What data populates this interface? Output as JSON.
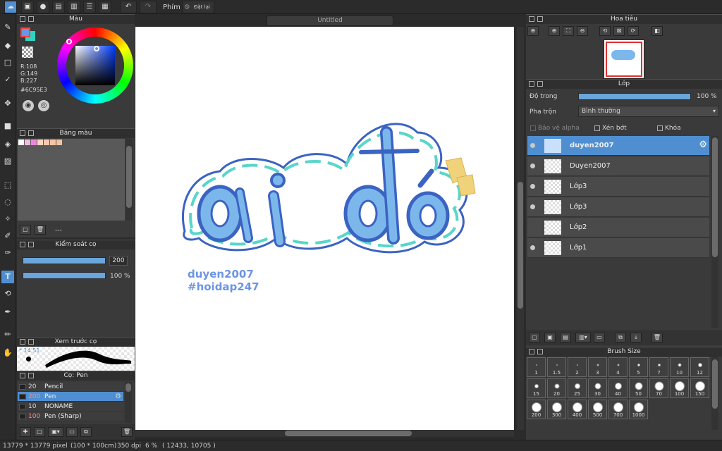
{
  "toolbar": {
    "hotkey_label": "Phím",
    "reset_label": "Đặt lại"
  },
  "document": {
    "title": "Untitled"
  },
  "color_panel": {
    "title": "Màu",
    "r": "R:108",
    "g": "G:149",
    "b": "B:227",
    "hex": "#6C95E3",
    "main_color": "#6C95E3",
    "sub_color": "#2ED3C3"
  },
  "palette_panel": {
    "title": "Bảng màu",
    "name": "---",
    "swatches": [
      "#ffffff",
      "#f5b8e6",
      "#e98ad8",
      "#fbd7c0",
      "#f7c9b2",
      "#f4c6a8",
      "#f2c3a0"
    ]
  },
  "brush_control": {
    "title": "Kiểm soát cọ",
    "size_value": "200",
    "opacity_value": "100 %"
  },
  "brush_preview": {
    "title": "Xem trước cọ",
    "size_label": "* 14.51"
  },
  "brush_list": {
    "title": "Cọ: Pen",
    "items": [
      {
        "size": "20",
        "name": "Pencil"
      },
      {
        "size": "200",
        "name": "Pen"
      },
      {
        "size": "10",
        "name": "NONAME"
      },
      {
        "size": "100",
        "name": "Pen (Sharp)"
      }
    ]
  },
  "canvas": {
    "art_title": "ai đó",
    "caption_line1": "duyen2007",
    "caption_line2": "#hoidap247"
  },
  "navigator": {
    "title": "Hoa tiêu"
  },
  "layer_panel": {
    "title": "Lớp",
    "opacity_label": "Độ trong",
    "opacity_value": "100 %",
    "blend_label": "Pha trộn",
    "blend_value": "Bình thường",
    "protect_alpha": "Bảo vệ alpha",
    "clipping": "Xén bớt",
    "lock": "Khóa",
    "layers": [
      {
        "name": "duyen2007"
      },
      {
        "name": "Duyen2007"
      },
      {
        "name": "Lớp3"
      },
      {
        "name": "Lớp3"
      },
      {
        "name": "Lớp2"
      },
      {
        "name": "Lớp1"
      }
    ]
  },
  "brush_size_panel": {
    "title": "Brush Size",
    "sizes": [
      "1",
      "1.5",
      "2",
      "3",
      "4",
      "5",
      "7",
      "10",
      "12",
      "15",
      "20",
      "25",
      "30",
      "40",
      "50",
      "70",
      "100",
      "150",
      "200",
      "300",
      "400",
      "500",
      "700",
      "1000"
    ]
  },
  "status_bar": {
    "dims": "13779 * 13779 pixel",
    "physical": "(100 * 100cm)",
    "dpi": "350 dpi",
    "zoom": "6 %",
    "coords": "( 12433, 10705 )"
  },
  "colors": {
    "accent": "#4f8fd1",
    "panel_bg": "#3a3a3a",
    "art_fill": "#7cb7ec",
    "art_outline": "#3b63c2"
  }
}
